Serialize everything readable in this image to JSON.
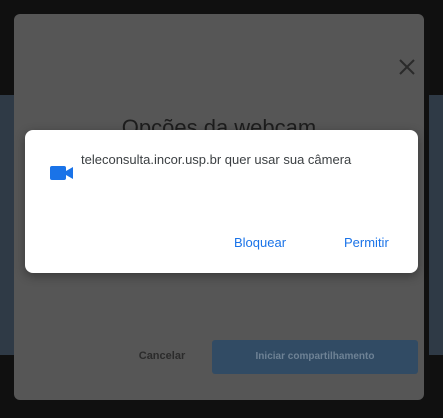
{
  "modal": {
    "title": "Opções da webcam",
    "cancel_label": "Cancelar",
    "share_label": "Iniciar compartilhamento"
  },
  "permission": {
    "message": "teleconsulta.incor.usp.br quer usar sua câmera",
    "block_label": "Bloquear",
    "allow_label": "Permitir",
    "icon": "video-camera-icon"
  },
  "colors": {
    "accent": "#1a73e8",
    "icon": "#1a73e8",
    "overlay": "#565656",
    "primary_button": "#314b64"
  }
}
